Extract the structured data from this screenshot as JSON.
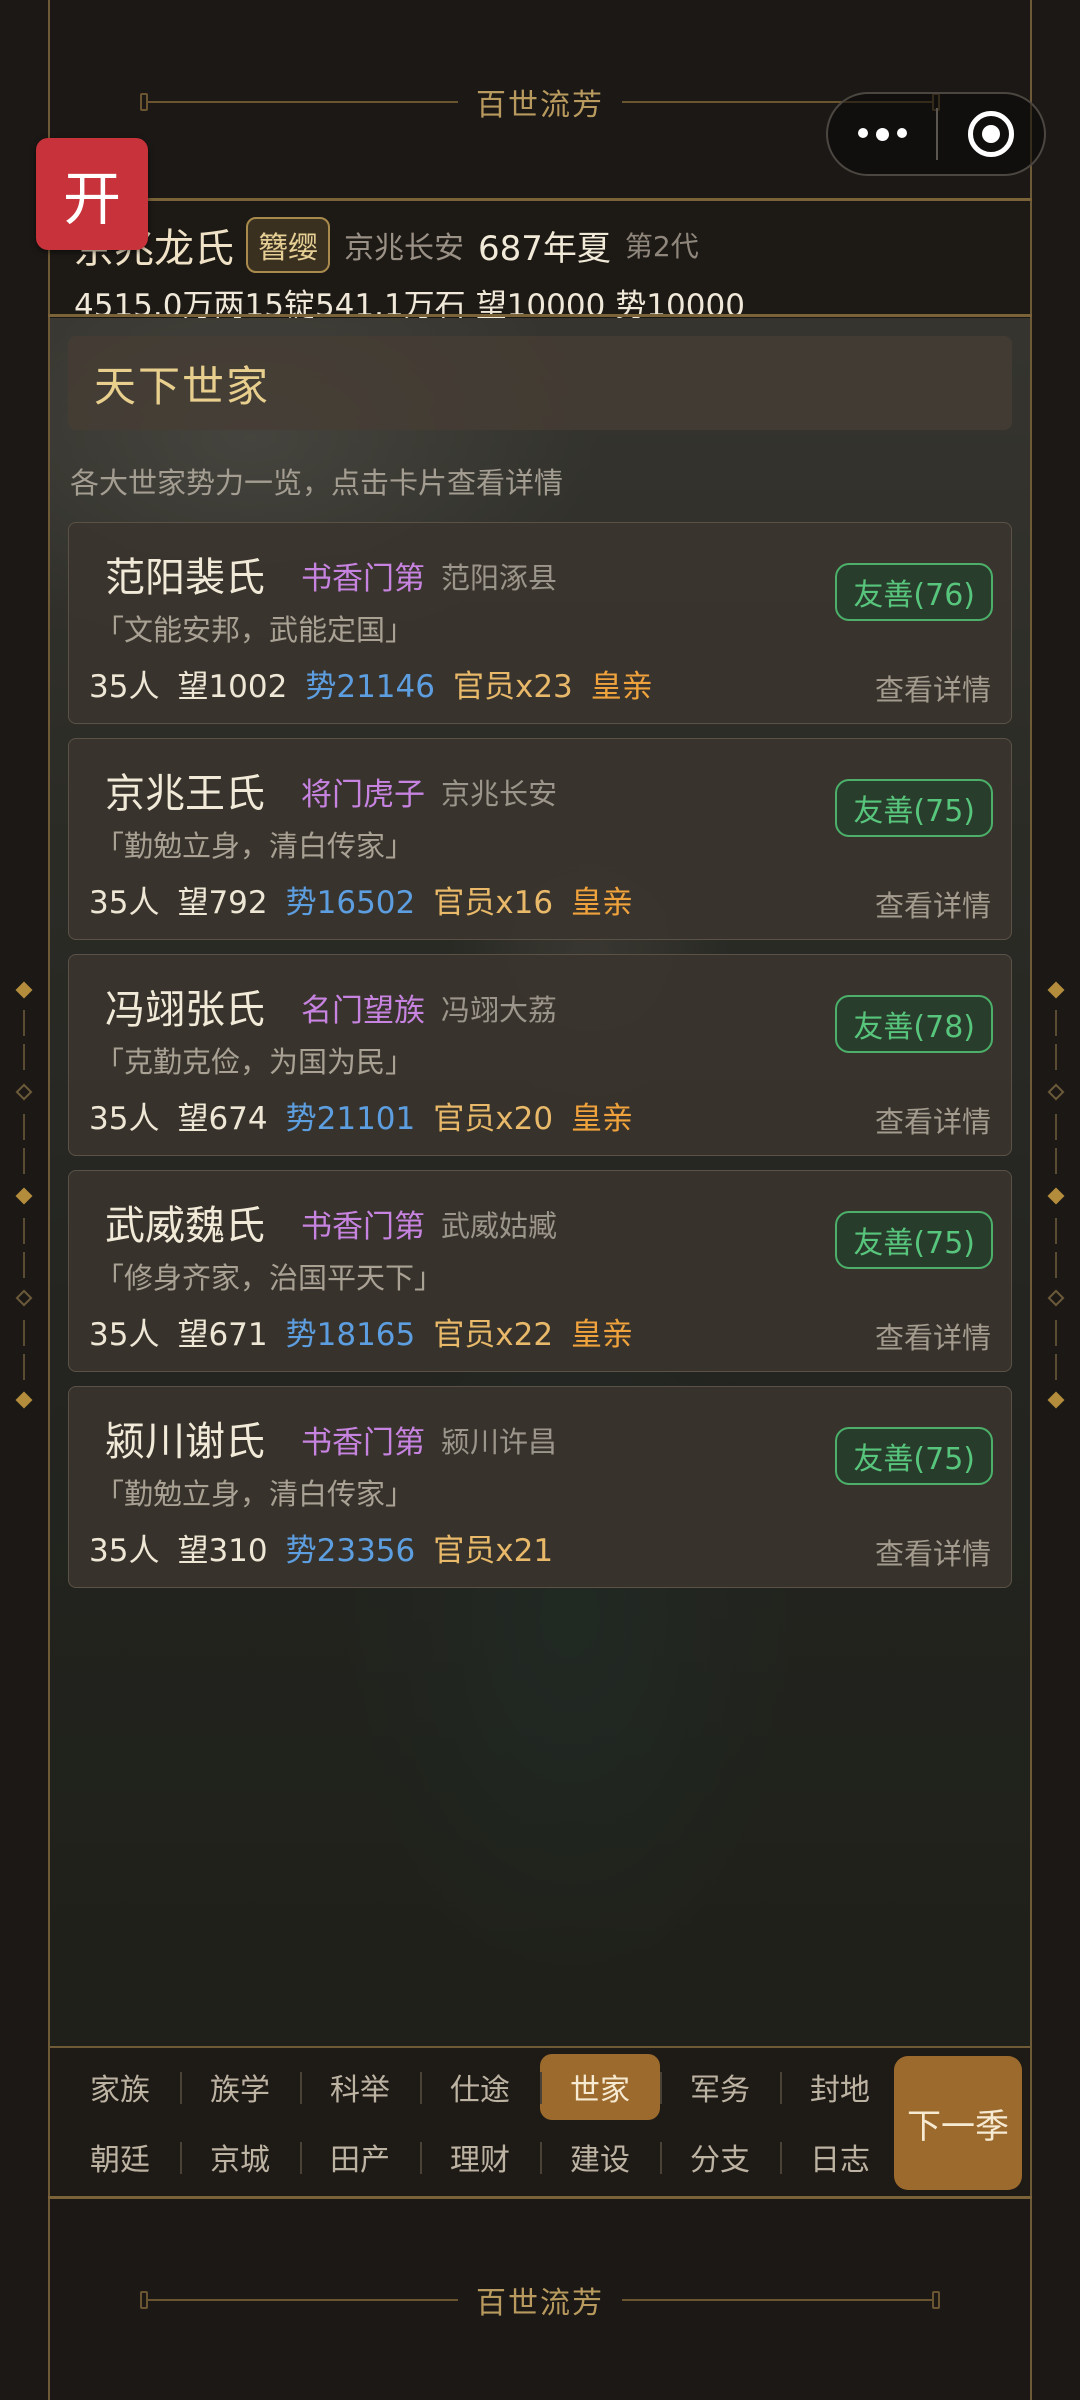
{
  "banner": {
    "text": "百世流芳"
  },
  "open_button": {
    "label": "开"
  },
  "header": {
    "clan_name": "京兆龙氏",
    "title_badge": "簪缨",
    "home": "京兆长安",
    "year": "687年夏",
    "generation": "第2代",
    "silver": "4515.0万两",
    "gold": "15锭",
    "grain": "541.1万石",
    "prestige": "望10000",
    "power": "势10000"
  },
  "section": {
    "title": "天下世家",
    "description": "各大世家势力一览，点击卡片查看详情"
  },
  "families": [
    {
      "name": "范阳裴氏",
      "type": "书香门第",
      "location": "范阳涿县",
      "motto": "「文能安邦，武能定国」",
      "people": "35人",
      "prestige": "望1002",
      "power": "势21146",
      "officials": "官员x23",
      "royal": "皇亲",
      "relation": "友善(76)",
      "detail": "查看详情"
    },
    {
      "name": "京兆王氏",
      "type": "将门虎子",
      "location": "京兆长安",
      "motto": "「勤勉立身，清白传家」",
      "people": "35人",
      "prestige": "望792",
      "power": "势16502",
      "officials": "官员x16",
      "royal": "皇亲",
      "relation": "友善(75)",
      "detail": "查看详情"
    },
    {
      "name": "冯翊张氏",
      "type": "名门望族",
      "location": "冯翊大荔",
      "motto": "「克勤克俭，为国为民」",
      "people": "35人",
      "prestige": "望674",
      "power": "势21101",
      "officials": "官员x20",
      "royal": "皇亲",
      "relation": "友善(78)",
      "detail": "查看详情"
    },
    {
      "name": "武威魏氏",
      "type": "书香门第",
      "location": "武威姑臧",
      "motto": "「修身齐家，治国平天下」",
      "people": "35人",
      "prestige": "望671",
      "power": "势18165",
      "officials": "官员x22",
      "royal": "皇亲",
      "relation": "友善(75)",
      "detail": "查看详情"
    },
    {
      "name": "颍川谢氏",
      "type": "书香门第",
      "location": "颍川许昌",
      "motto": "「勤勉立身，清白传家」",
      "people": "35人",
      "prestige": "望310",
      "power": "势23356",
      "officials": "官员x21",
      "royal": "",
      "relation": "友善(75)",
      "detail": "查看详情"
    }
  ],
  "nav": {
    "row1": [
      "家族",
      "族学",
      "科举",
      "仕途",
      "世家",
      "军务",
      "封地"
    ],
    "row2": [
      "朝廷",
      "京城",
      "田产",
      "理财",
      "建设",
      "分支",
      "日志"
    ],
    "active": "世家",
    "next_label": "下一季"
  },
  "icons": {
    "menu": "more-dots-icon",
    "close": "target-circle-icon"
  },
  "colors": {
    "accent": "#9c6a2c",
    "gold_text": "#e8cf8e",
    "friendly": "#58c57c",
    "power": "#5d9ee0",
    "type": "#c783e0"
  }
}
